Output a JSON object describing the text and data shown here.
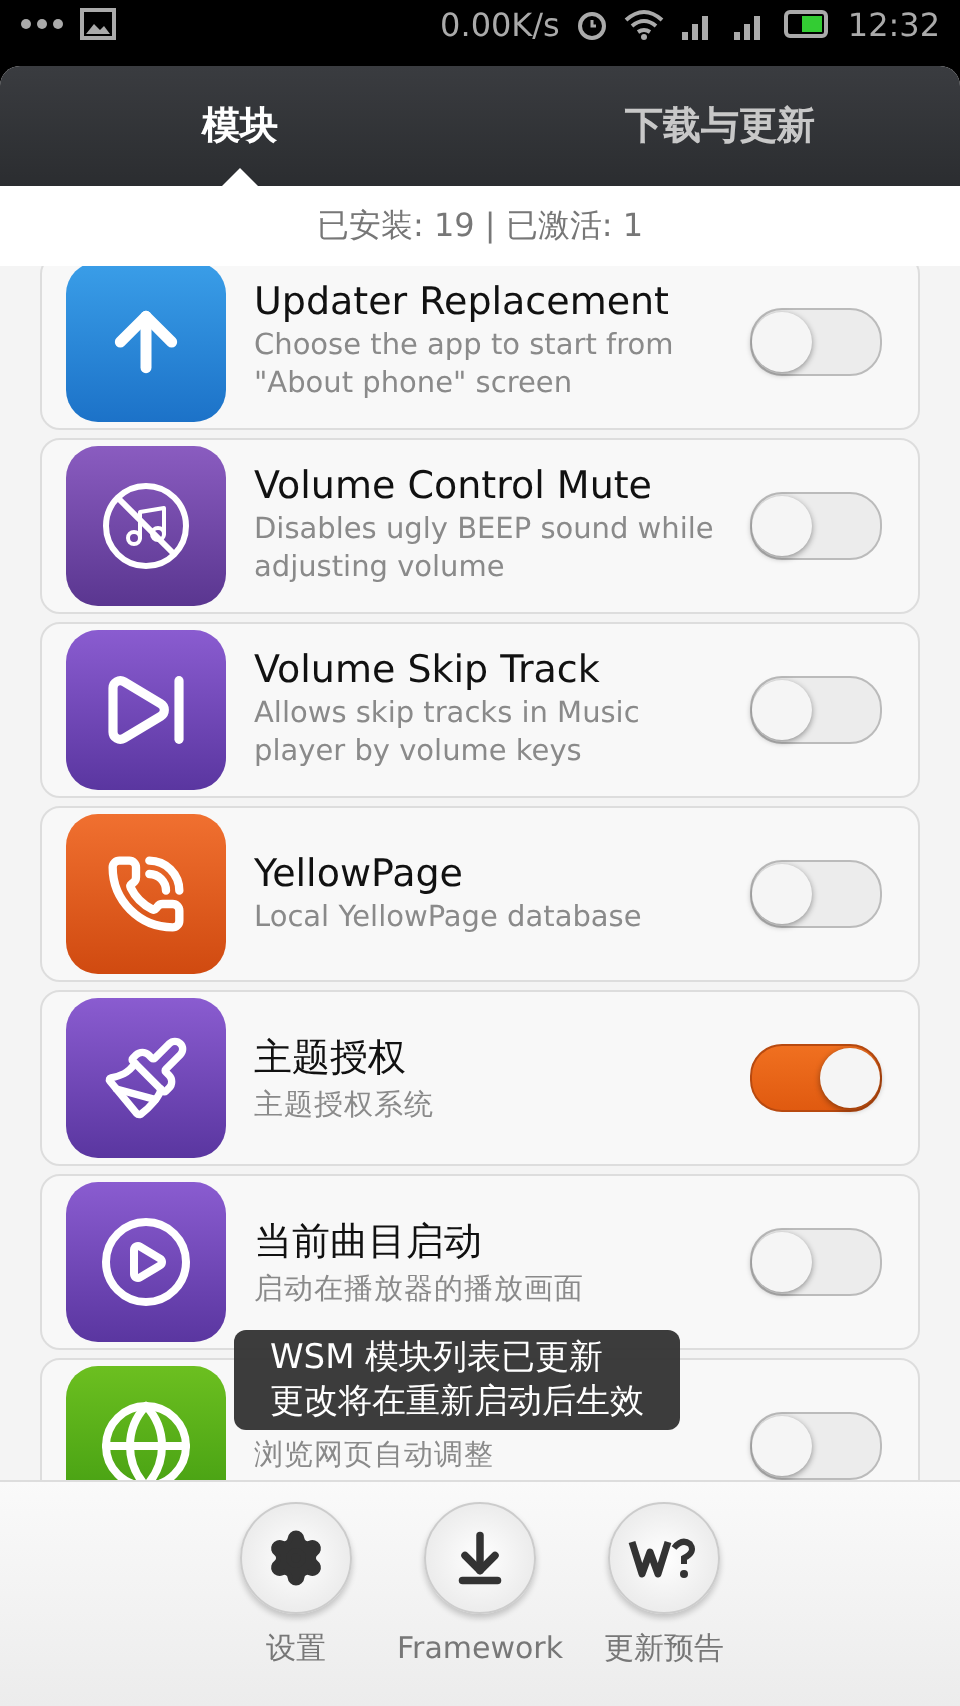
{
  "status_bar": {
    "speed": "0.00K/s",
    "time": "12:32"
  },
  "tabs": [
    {
      "label": "模块",
      "selected": true
    },
    {
      "label": "下载与更新",
      "selected": false
    }
  ],
  "summary": "已安装: 19 | 已激活: 1",
  "modules": [
    {
      "title": "Updater Replacement",
      "description": "Choose the app to start from \"About phone\" screen",
      "on": false
    },
    {
      "title": "Volume Control Mute",
      "description": "Disables ugly BEEP sound while adjusting volume",
      "on": false
    },
    {
      "title": "Volume Skip Track",
      "description": "Allows skip tracks in Music player by volume keys",
      "on": false
    },
    {
      "title": "YellowPage",
      "description": "Local YellowPage database",
      "on": false
    },
    {
      "title": "主题授权",
      "description": "主题授权系统",
      "on": true
    },
    {
      "title": "当前曲目启动",
      "description": "启动在播放器的播放画面",
      "on": false
    },
    {
      "description": "浏览网页自动调整",
      "on": false
    }
  ],
  "toast": [
    "WSM 模块列表已更新",
    "更改将在重新启动后生效"
  ],
  "bottom_actions": [
    {
      "label": "设置"
    },
    {
      "label": "Framework"
    },
    {
      "label": "更新预告"
    }
  ]
}
